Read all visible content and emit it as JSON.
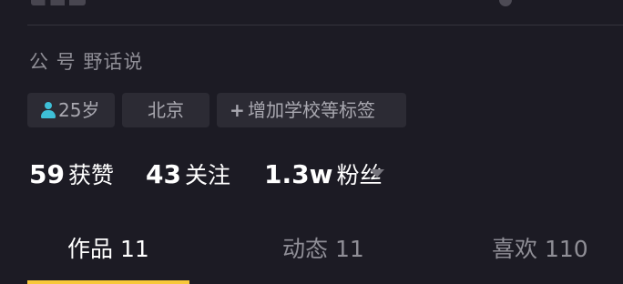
{
  "profile": {
    "id_line": "公 号 野话说"
  },
  "tags": {
    "age_icon": "person-icon",
    "age": "25岁",
    "city": "北京",
    "add_icon": "plus-icon",
    "add_label": "增加学校等标签"
  },
  "stats": {
    "likes_count": "59",
    "likes_label": "获赞",
    "following_count": "43",
    "following_label": "关注",
    "fans_count": "1.3w",
    "fans_label": "粉丝",
    "fans_caret_icon": "caret-down-icon"
  },
  "tabs": [
    {
      "label": "作品 11",
      "active": true
    },
    {
      "label": "动态 11",
      "active": false
    },
    {
      "label": "喜欢 110",
      "active": false
    }
  ],
  "colors": {
    "background": "#1c1b24",
    "tag_background": "#2c2b34",
    "active_tab_underline": "#f7c83a",
    "age_icon": "#3ec0d8",
    "muted_text": "#8f8e96"
  }
}
